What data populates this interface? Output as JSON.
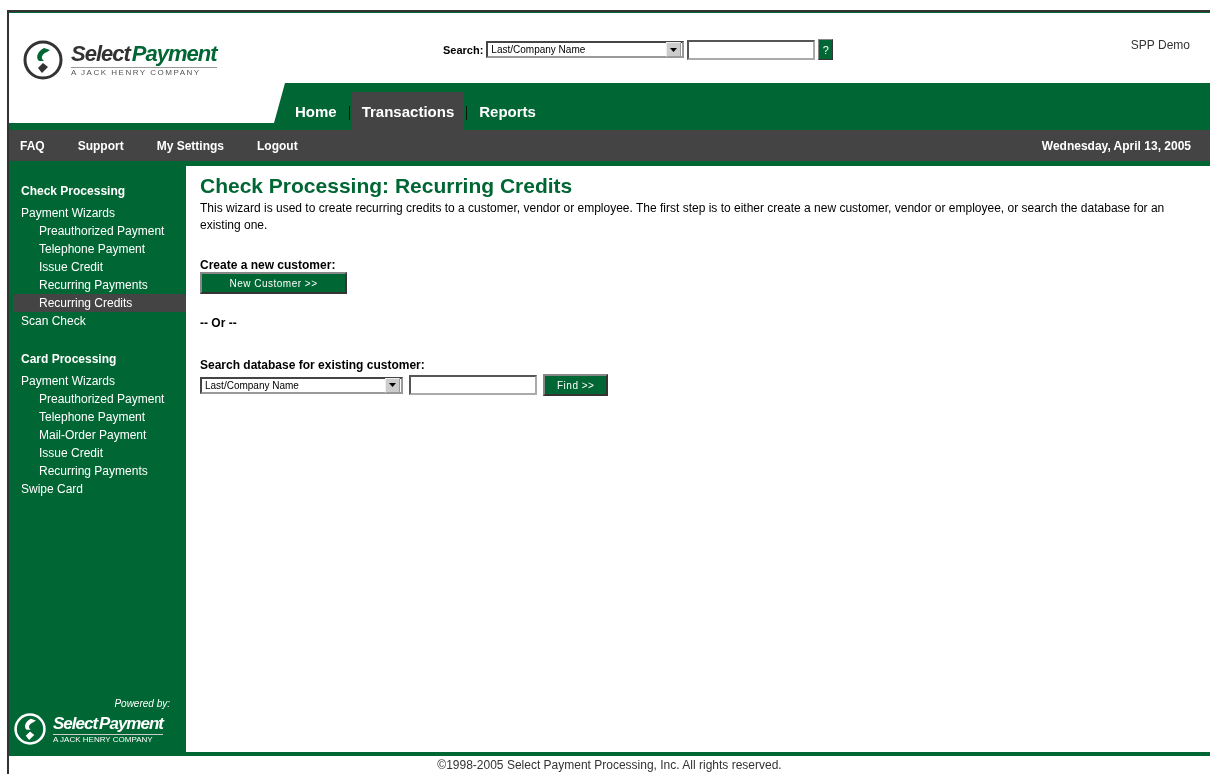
{
  "logo": {
    "word1": "Select",
    "word2": "Payment",
    "tagline": "A JACK HENRY COMPANY"
  },
  "search": {
    "label": "Search:",
    "field_select": "Last/Company Name",
    "help": "?"
  },
  "user": "SPP Demo",
  "tabs": [
    {
      "label": "Home",
      "selected": false
    },
    {
      "label": "Transactions",
      "selected": true
    },
    {
      "label": "Reports",
      "selected": false
    }
  ],
  "menu": [
    "FAQ",
    "Support",
    "My Settings",
    "Logout"
  ],
  "date": "Wednesday, April 13, 2005",
  "sidebar": {
    "sections": [
      {
        "title": "Check Processing",
        "items": [
          {
            "label": "Payment Wizards",
            "selected": false,
            "children": [
              {
                "label": "Preauthorized Payment",
                "selected": false
              },
              {
                "label": "Telephone Payment",
                "selected": false
              },
              {
                "label": "Issue Credit",
                "selected": false
              },
              {
                "label": "Recurring Payments",
                "selected": false
              },
              {
                "label": "Recurring Credits",
                "selected": true
              }
            ]
          },
          {
            "label": "Scan Check",
            "selected": false
          }
        ]
      },
      {
        "title": "Card Processing",
        "items": [
          {
            "label": "Payment Wizards",
            "selected": false,
            "children": [
              {
                "label": "Preauthorized Payment",
                "selected": false
              },
              {
                "label": "Telephone Payment",
                "selected": false
              },
              {
                "label": "Mail-Order Payment",
                "selected": false
              },
              {
                "label": "Issue Credit",
                "selected": false
              },
              {
                "label": "Recurring Payments",
                "selected": false
              }
            ]
          },
          {
            "label": "Swipe Card",
            "selected": false
          }
        ]
      }
    ],
    "powered_by": "Powered by:",
    "logo": {
      "word1": "Select",
      "word2": "Payment",
      "tagline": "A JACK HENRY COMPANY"
    }
  },
  "page": {
    "title": "Check Processing: Recurring Credits",
    "intro": "This wizard is used to create recurring credits to a customer, vendor or employee. The first step is to either create a new customer, vendor or employee, or search the database for an existing one.",
    "create_label": "Create a new customer:",
    "create_button": "New Customer >>",
    "or": "-- Or --",
    "search_label": "Search database for existing customer:",
    "search_select": "Last/Company Name",
    "find_button": "Find >>"
  },
  "footer": "©1998-2005 Select Payment Processing, Inc. All rights reserved."
}
